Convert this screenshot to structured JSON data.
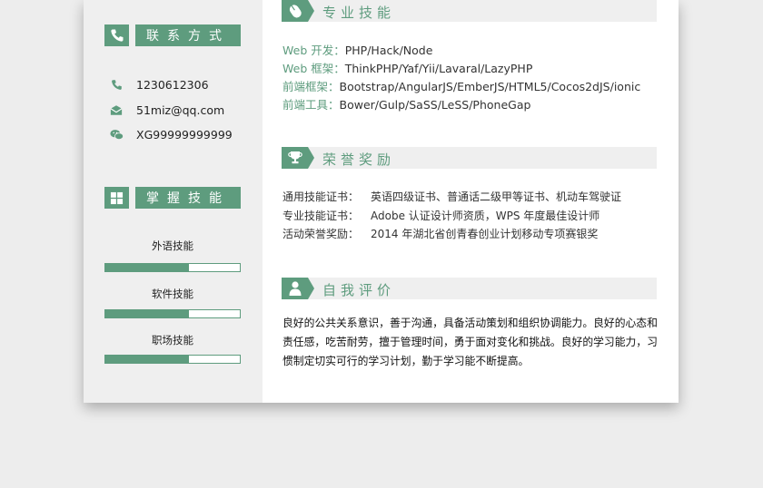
{
  "colors": {
    "accent": "#5e9c7e",
    "panel": "#efefef",
    "bg": "#ededed"
  },
  "sidebar": {
    "contact": {
      "title": "联系方式",
      "icon": "phone-icon",
      "items": [
        {
          "icon": "phone-icon",
          "text": "1230612306"
        },
        {
          "icon": "mail-icon",
          "text": "51miz@qq.com"
        },
        {
          "icon": "wechat-icon",
          "text": "XG99999999999"
        }
      ]
    },
    "skills": {
      "title": "掌握技能",
      "icon": "windows-icon",
      "items": [
        {
          "label": "外语技能",
          "level": 0.62
        },
        {
          "label": "软件技能",
          "level": 0.62
        },
        {
          "label": "职场技能",
          "level": 0.62
        }
      ]
    }
  },
  "main": {
    "professional": {
      "title": "专业技能",
      "icon": "mouse-icon",
      "items": [
        {
          "key": "Web 开发：",
          "value": "PHP/Hack/Node"
        },
        {
          "key": "Web 框架：",
          "value": "ThinkPHP/Yaf/Yii/Lavaral/LazyPHP"
        },
        {
          "key": "前端框架：",
          "value": "Bootstrap/AngularJS/EmberJS/HTML5/Cocos2dJS/ionic"
        },
        {
          "key": "前端工具：",
          "value": "Bower/Gulp/SaSS/LeSS/PhoneGap"
        }
      ]
    },
    "honors": {
      "title": "荣誉奖励",
      "icon": "trophy-icon",
      "items": [
        {
          "key": "通用技能证书：",
          "value": "英语四级证书、普通话二级甲等证书、机动车驾驶证"
        },
        {
          "key": "专业技能证书：",
          "value": "Adobe 认证设计师资质，WPS 年度最佳设计师"
        },
        {
          "key": "活动荣誉奖励：",
          "value": "2014 年湖北省创青春创业计划移动专项赛银奖"
        }
      ]
    },
    "evaluation": {
      "title": "自我评价",
      "icon": "person-icon",
      "text": "良好的公共关系意识，善于沟通，具备活动策划和组织协调能力。良好的心态和责任感，吃苦耐劳，擅于管理时间，勇于面对变化和挑战。良好的学习能力，习惯制定切实可行的学习计划，勤于学习能不断提高。"
    }
  }
}
